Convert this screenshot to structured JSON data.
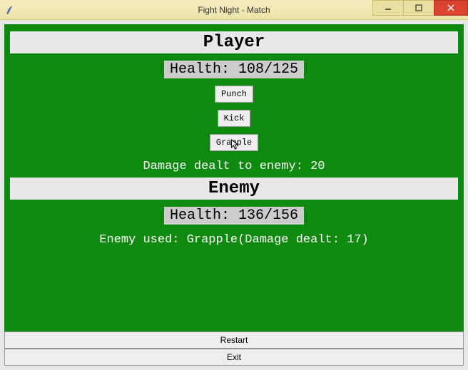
{
  "window": {
    "title": "Fight Night - Match",
    "minimize": "—",
    "maximize": "☐",
    "close": "✕"
  },
  "player": {
    "label": "Player",
    "health_text": "Health: 108/125",
    "health_current": 108,
    "health_max": 125
  },
  "actions": {
    "punch": "Punch",
    "kick": "Kick",
    "grapple": "Grapple"
  },
  "player_status": "Damage dealt to enemy: 20",
  "enemy": {
    "label": "Enemy",
    "health_text": "Health: 136/156",
    "health_current": 136,
    "health_max": 156
  },
  "enemy_status": "Enemy used: Grapple(Damage dealt: 17)",
  "footer": {
    "restart": "Restart",
    "exit": "Exit"
  }
}
